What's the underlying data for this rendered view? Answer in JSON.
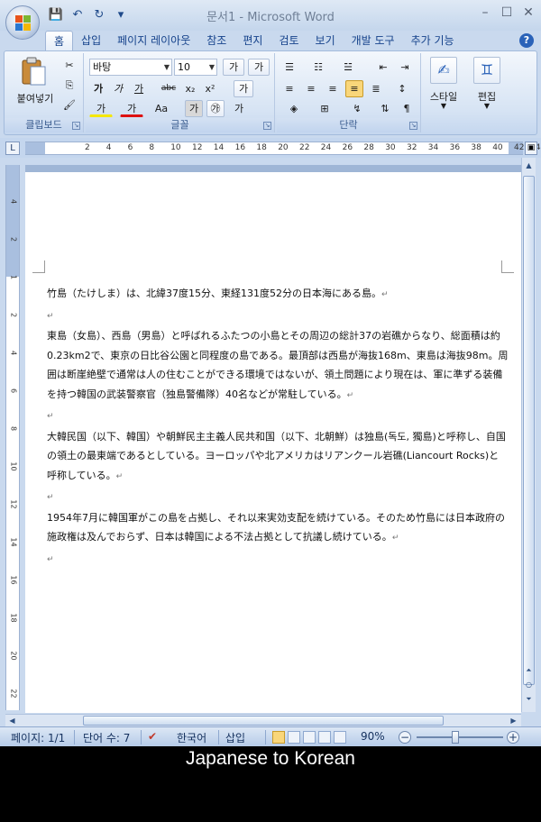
{
  "window": {
    "title": "문서1 - Microsoft Word",
    "controls": {
      "minimize": "–",
      "maximize": "☐",
      "close": "✕"
    }
  },
  "quick_access": {
    "save": "💾",
    "undo": "↶",
    "redo": "↻",
    "customize": "▾"
  },
  "tabs": [
    {
      "label": "홈",
      "active": true
    },
    {
      "label": "삽입"
    },
    {
      "label": "페이지 레이아웃"
    },
    {
      "label": "참조"
    },
    {
      "label": "편지"
    },
    {
      "label": "검토"
    },
    {
      "label": "보기"
    },
    {
      "label": "개발 도구"
    },
    {
      "label": "추가 기능"
    }
  ],
  "help_label": "?",
  "ribbon": {
    "clipboard": {
      "label": "클립보드",
      "paste_label": "붙여넣기"
    },
    "font": {
      "label": "글꼴",
      "font_name": "바탕",
      "font_size": "10",
      "grow": "가",
      "shrink": "가",
      "bold": "가",
      "italic": "가",
      "underline": "가",
      "strike": "abc",
      "subscript": "x₂",
      "superscript": "x²",
      "case": "Aa",
      "highlight": "가",
      "font_color": "가",
      "clear": "가",
      "encircle": "㉮",
      "phonetic": "가"
    },
    "paragraph": {
      "label": "단락"
    },
    "styles": {
      "label": "스타일"
    },
    "editing": {
      "label": "편집"
    }
  },
  "ruler": {
    "ticks": [
      "2",
      "4",
      "6",
      "8",
      "10",
      "12",
      "14",
      "16",
      "18",
      "20",
      "22",
      "24",
      "26",
      "28",
      "30",
      "32",
      "34",
      "36",
      "38",
      "40",
      "42",
      "44"
    ],
    "vticks": [
      "4",
      "2",
      "1",
      "2",
      "4",
      "6",
      "8",
      "10",
      "12",
      "14",
      "16",
      "18",
      "20",
      "22"
    ]
  },
  "document": {
    "paragraphs": [
      "竹島（たけしま）は、北緯37度15分、東経131度52分の日本海にある島。",
      "",
      "東島（女島）、西島（男島）と呼ばれるふたつの小島とその周辺の総計37の岩礁からなり、総面積は約0.23km2で、東京の日比谷公園と同程度の島である。最頂部は西島が海抜168m、東島は海抜98m。周囲は断崖絶壁で通常は人の住むことができる環境ではないが、領土問題により現在は、軍に準ずる装備を持つ韓国の武装警察官（独島警備隊）40名などが常駐している。",
      "",
      "大韓民国（以下、韓国）や朝鮮民主主義人民共和国（以下、北朝鮮）は独島(독도, 獨島)と呼称し、自国の領土の最東端であるとしている。ヨーロッパや北アメリカはリアンクール岩礁(Liancourt Rocks)と呼称している。",
      "",
      "1954年7月に韓国軍がこの島を占拠し、それ以来実効支配を続けている。そのため竹島には日本政府の施政権は及んでおらず、日本は韓国による不法占拠として抗議し続けている。",
      ""
    ]
  },
  "statusbar": {
    "page": "페이지: 1/1",
    "words": "단어 수: 7",
    "language": "한국어",
    "mode": "삽입",
    "zoom": "90%",
    "zoom_fraction": 0.45
  },
  "caption": "Japanese to Korean"
}
